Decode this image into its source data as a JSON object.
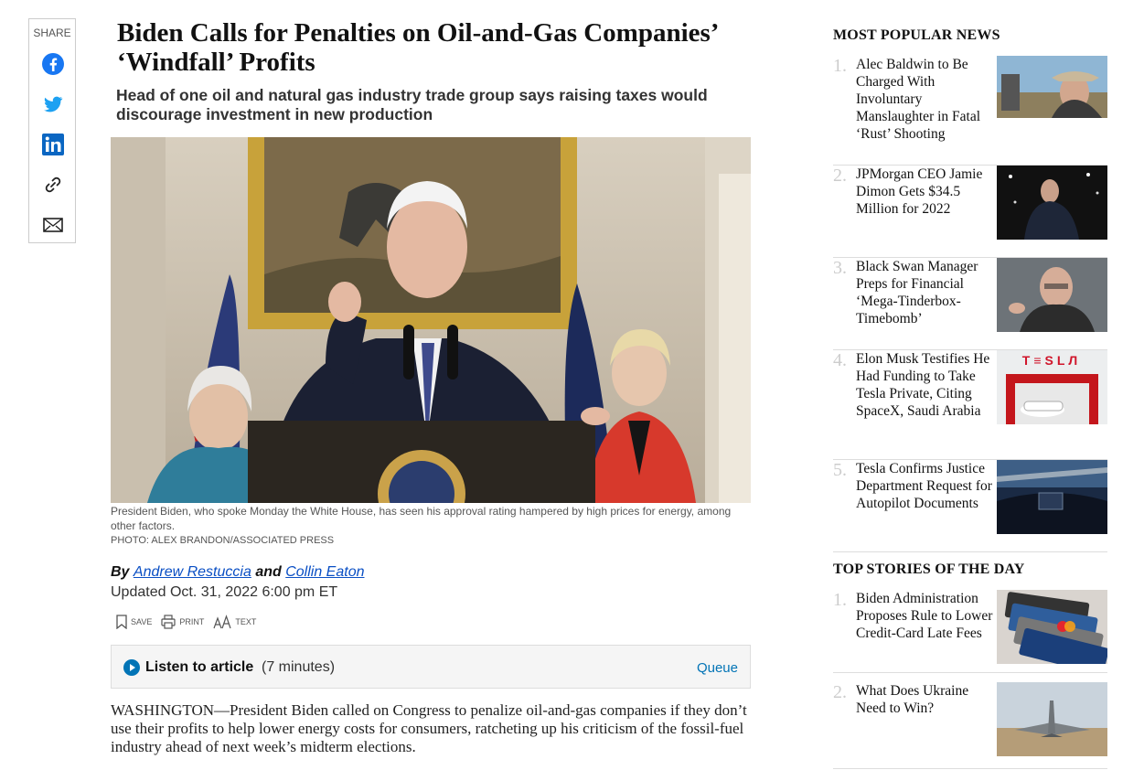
{
  "share": {
    "label": "SHARE",
    "icons": [
      "facebook-icon",
      "twitter-icon",
      "linkedin-icon",
      "link-icon",
      "email-icon"
    ]
  },
  "article": {
    "headline": "Biden Calls for Penalties on Oil-and-Gas Companies’ ‘Windfall’ Profits",
    "dek": "Head of one oil and natural gas industry trade group says raising taxes would discourage investment in new production",
    "caption": "President Biden, who spoke Monday the White House, has seen his approval rating hampered by high prices for energy, among other factors.",
    "credit": "PHOTO: ALEX BRANDON/ASSOCIATED PRESS",
    "byline_by": "By",
    "author1": "Andrew Restuccia",
    "byline_and": "and",
    "author2": "Collin Eaton",
    "updated": "Updated Oct. 31, 2022 6:00 pm ET",
    "tools": {
      "save": "SAVE",
      "print": "PRINT",
      "text": "TEXT"
    },
    "listen": {
      "label": "Listen to article",
      "duration": "(7 minutes)",
      "queue": "Queue"
    },
    "body": "WASHINGTON—President Biden called on Congress to penalize oil-and-gas companies if they don’t use their profits to help lower energy costs for consumers, ratcheting up his criticism of the fossil-fuel industry ahead of next week’s midterm elections."
  },
  "sidebar": {
    "popular_title": "MOST POPULAR NEWS",
    "popular": [
      {
        "num": "1.",
        "title": "Alec Baldwin to Be Charged With Involuntary Manslaughter in Fatal ‘Rust’ Shooting"
      },
      {
        "num": "2.",
        "title": "JPMorgan CEO Jamie Dimon Gets $34.5 Million for 2022"
      },
      {
        "num": "3.",
        "title": "Black Swan Manager Preps for Financial ‘Mega-Tinderbox-Timebomb’"
      },
      {
        "num": "4.",
        "title": "Elon Musk Testifies He Had Funding to Take Tesla Private, Citing SpaceX, Saudi Arabia"
      },
      {
        "num": "5.",
        "title": "Tesla Confirms Justice Department Request for Autopilot Documents"
      }
    ],
    "top_title": "TOP STORIES OF THE DAY",
    "top": [
      {
        "num": "1.",
        "title": "Biden Administration Proposes Rule to Lower Credit-Card Late Fees"
      },
      {
        "num": "2.",
        "title": "What Does Ukraine Need to Win?"
      }
    ]
  }
}
